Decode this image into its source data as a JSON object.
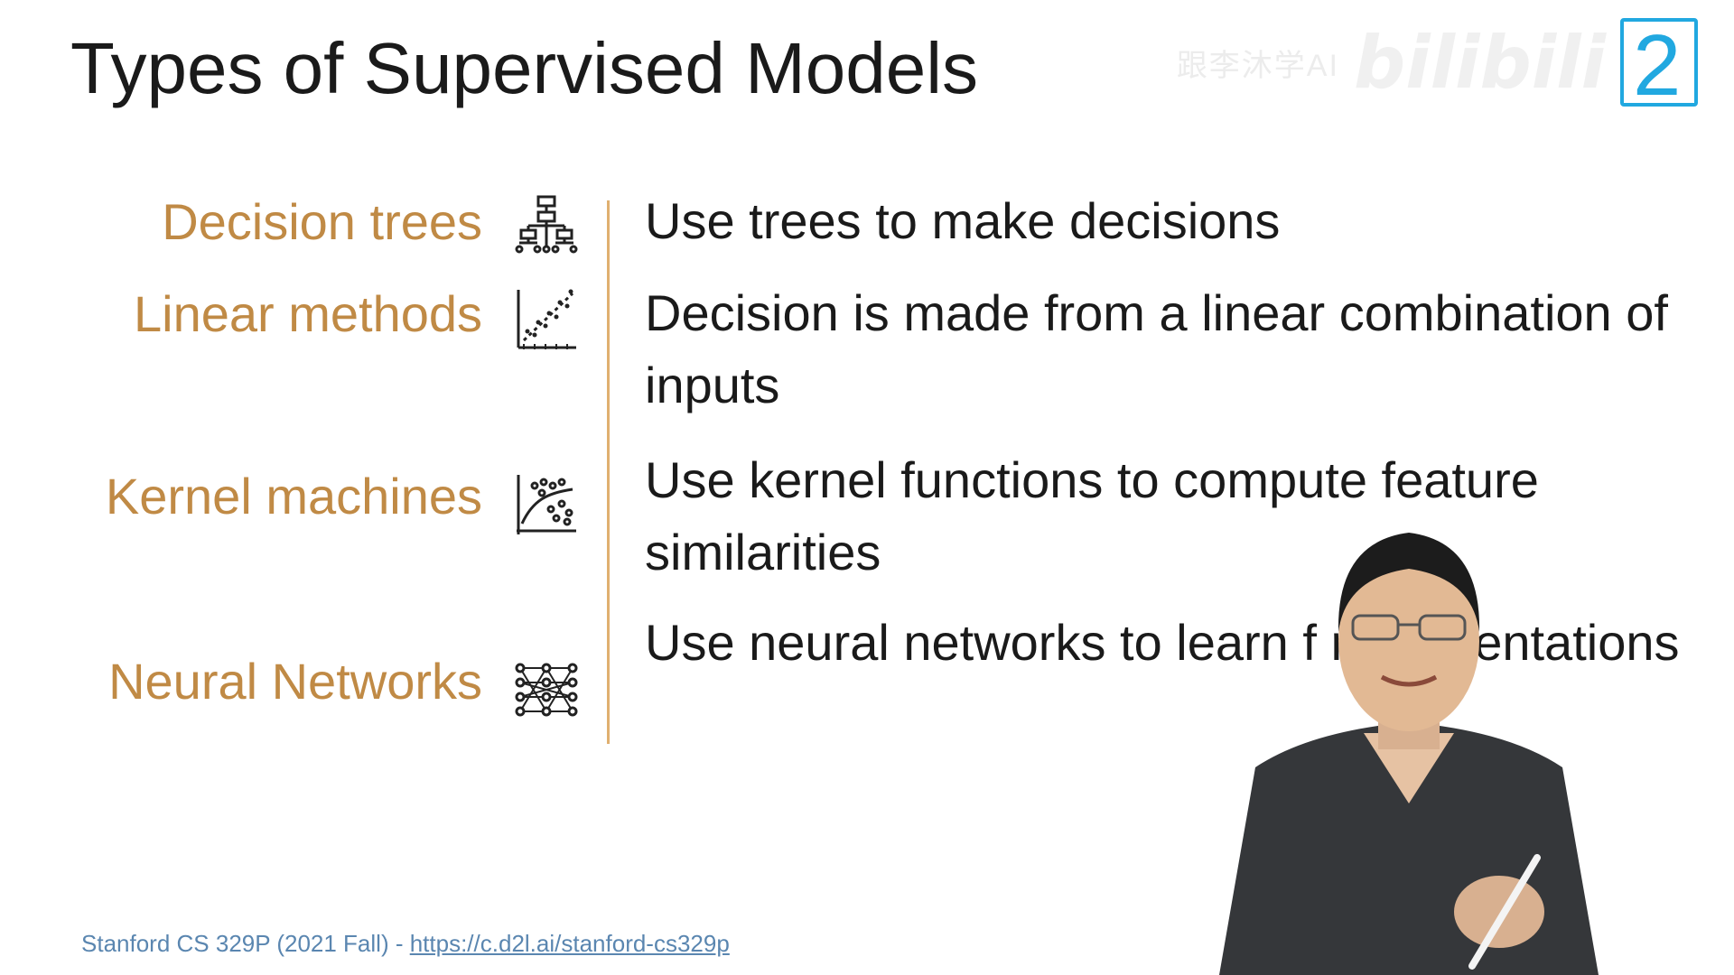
{
  "slide": {
    "title": "Types of Supervised Models",
    "watermark_text": "跟李沐学AI",
    "watermark_logo": "bilibili",
    "logo_glyph": "2"
  },
  "models": [
    {
      "name": "Decision trees",
      "icon": "decision-tree-icon",
      "description": "Use trees to make decisions"
    },
    {
      "name": "Linear methods",
      "icon": "linear-scatter-icon",
      "description": "Decision is made from a linear combination of inputs"
    },
    {
      "name": "Kernel machines",
      "icon": "kernel-scatter-icon",
      "description": "Use kernel functions to compute feature similarities"
    },
    {
      "name": "Neural Networks",
      "icon": "neural-network-icon",
      "description": "Use neural networks to learn f representations"
    }
  ],
  "footer": {
    "source": "Stanford CS 329P (2021 Fall) - ",
    "link_text": "https://c.d2l.ai/stanford-cs329p"
  },
  "colors": {
    "accent": "#c08a45",
    "divider": "#e0b070",
    "text": "#1a1a1a",
    "link": "#5a86b0",
    "logo": "#21a8e0"
  }
}
